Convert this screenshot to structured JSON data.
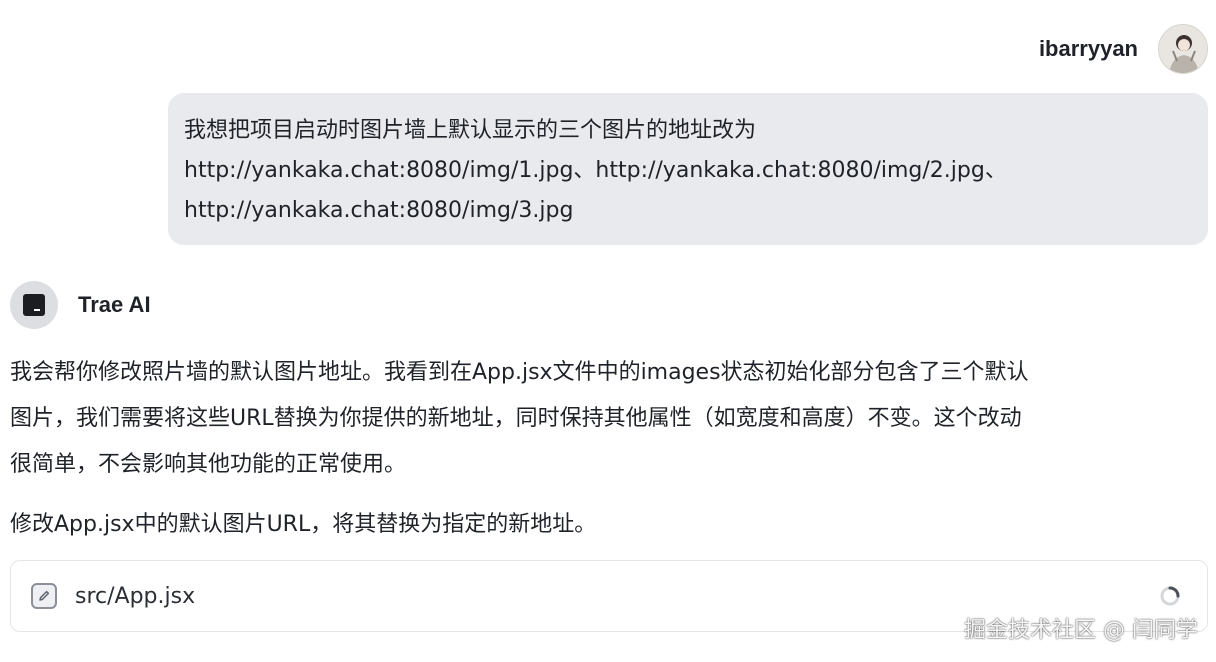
{
  "user": {
    "name": "ibarryyan",
    "avatar_icon": "user-avatar-photo",
    "message_lines": [
      "我想把项目启动时图片墙上默认显示的三个图片的地址改为",
      "http://yankaka.chat:8080/img/1.jpg、http://yankaka.chat:8080/img/2.jpg、",
      "http://yankaka.chat:8080/img/3.jpg"
    ]
  },
  "assistant": {
    "name": "Trae AI",
    "avatar_icon": "trae-logo-icon",
    "paragraph1_lines": [
      "我会帮你修改照片墙的默认图片地址。我看到在App.jsx文件中的images状态初始化部分包含了三个默认",
      "图片，我们需要将这些URL替换为你提供的新地址，同时保持其他属性（如宽度和高度）不变。这个改动",
      "很简单，不会影响其他功能的正常使用。"
    ],
    "paragraph2": "修改App.jsx中的默认图片URL，将其替换为指定的新地址。"
  },
  "file_card": {
    "icon": "edit-file-icon",
    "file_name": "src/App.jsx",
    "status_icon": "loading-spinner-icon"
  },
  "watermark": "掘金技术社区 @ 闫同学",
  "colors": {
    "user_bubble_bg": "#e8eaed",
    "text": "#1f2329",
    "card_border": "#e3e5e8"
  }
}
